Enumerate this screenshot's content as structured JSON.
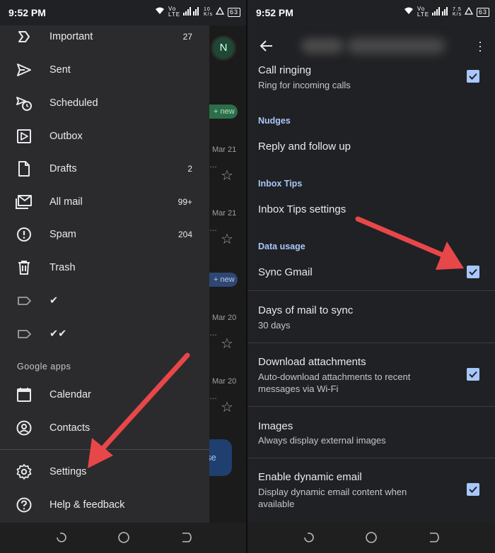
{
  "status": {
    "time": "9:52 PM",
    "signal_left": "Vo LTE",
    "speed_left": "10 K/s",
    "speed_right": "7.5 K/s",
    "battery": "63"
  },
  "drawer": {
    "items": [
      {
        "label": "Important",
        "count": "27",
        "icon": "important-icon"
      },
      {
        "label": "Sent",
        "count": "",
        "icon": "send-icon"
      },
      {
        "label": "Scheduled",
        "count": "",
        "icon": "schedule-icon"
      },
      {
        "label": "Outbox",
        "count": "",
        "icon": "outbox-icon"
      },
      {
        "label": "Drafts",
        "count": "2",
        "icon": "draft-icon"
      },
      {
        "label": "All mail",
        "count": "99+",
        "icon": "all-mail-icon"
      },
      {
        "label": "Spam",
        "count": "204",
        "icon": "spam-icon"
      },
      {
        "label": "Trash",
        "count": "",
        "icon": "trash-icon"
      },
      {
        "label": "✔",
        "count": "",
        "icon": "label-icon"
      },
      {
        "label": "✔✔",
        "count": "",
        "icon": "label-icon"
      }
    ],
    "section_google_apps": "Google apps",
    "apps": [
      {
        "label": "Calendar",
        "icon": "calendar-icon"
      },
      {
        "label": "Contacts",
        "icon": "contacts-icon"
      }
    ],
    "footer": [
      {
        "label": "Settings",
        "icon": "gear-icon"
      },
      {
        "label": "Help & feedback",
        "icon": "help-icon"
      }
    ]
  },
  "inbox_bg": {
    "avatar_letter": "N",
    "chip_green": "+ new",
    "chip_blue": "+ new",
    "dates": [
      "Mar 21",
      "Mar 21",
      "Mar 20",
      "Mar 20"
    ],
    "compose": "se"
  },
  "settings": {
    "call_ringing_title": "Call ringing",
    "call_ringing_sub": "Ring for incoming calls",
    "cat_nudges": "Nudges",
    "nudges_item": "Reply and follow up",
    "cat_inbox_tips": "Inbox Tips",
    "inbox_tips_item": "Inbox Tips settings",
    "cat_data_usage": "Data usage",
    "sync_gmail": "Sync Gmail",
    "days_title": "Days of mail to sync",
    "days_sub": "30 days",
    "download_title": "Download attachments",
    "download_sub": "Auto-download attachments to recent messages via Wi-Fi",
    "images_title": "Images",
    "images_sub": "Always display external images",
    "dynamic_title": "Enable dynamic email",
    "dynamic_sub": "Display dynamic email content when available"
  },
  "colors": {
    "accent": "#a8c7fa",
    "arrow": "#e8474a",
    "drawer_bg": "#2b2b2e"
  }
}
